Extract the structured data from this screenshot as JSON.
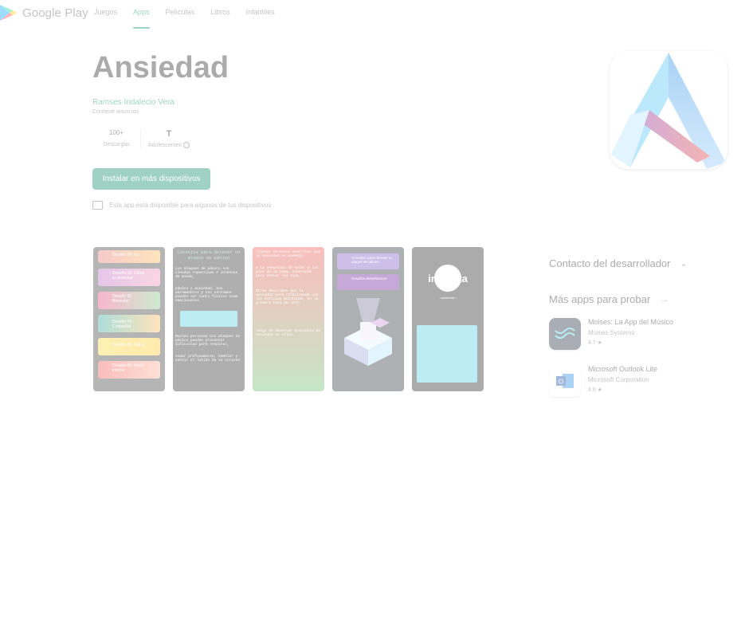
{
  "header": {
    "logo_text": "Google Play",
    "nav": [
      {
        "label": "Juegos",
        "active": false
      },
      {
        "label": "Apps",
        "active": true
      },
      {
        "label": "Películas",
        "active": false
      },
      {
        "label": "Libros",
        "active": false
      },
      {
        "label": "Infantiles",
        "active": false
      }
    ]
  },
  "app": {
    "title": "Ansiedad",
    "developer": "Ramses Indalecio Vera",
    "ads_note": "Contiene anuncios",
    "downloads_value": "100+",
    "downloads_label": "Descargas",
    "rating_icon": "T",
    "rating_label": "Adolescentes",
    "install_label": "Instalar en más dispositivos",
    "availability": "Esta app está disponible para algunos de tus dispositivos"
  },
  "screenshots": {
    "s1": [
      "Desafío 00: Ira",
      "Desafío 00: Cómo la ansiedad",
      "Desafío 00: Bienestar",
      "Desafío 00: Compañía",
      "Desafío 00: Salud",
      "Desafío 00: Ruido interno"
    ],
    "s2_title": "Consejos para detener un ataque de pánico",
    "s2_lines": [
      "Los ataques de pánico son oleadas repentinas e intensas de miedo,",
      "pánico o ansiedad. Son abrumadores y sus síntomas pueden ser tanto físicos como emocionales.",
      "Muchas personas con ataques de pánico pueden presentar dificultad para respirar,",
      "sudar profusamente, temblar y sentir el latido de su corazón"
    ],
    "s3_lines": [
      "Algunas personas describen que la ansiedad se asemeja",
      "a la sensación de estar a los pies de la cama, esperando para chocar los ojos.",
      "Otras describen que la ansiedad está relacionada con las noticias matutinas, en la primera taza de café,",
      "luego de observar episodios de ansiedad en ellos."
    ],
    "s4_items": [
      "Consejos para detener un ataque de pánico",
      "Desafíos Beneficiosos"
    ],
    "s5_title": "inquieta",
    "s5_sub": "• ansiedad •"
  },
  "sidebar": {
    "contact_title": "Contacto del desarrollador",
    "more_apps_title": "Más apps para probar",
    "recs": [
      {
        "name": "Moises: La App del Músico",
        "developer": "Moises Systems",
        "rating": "4.7 ★"
      },
      {
        "name": "Microsoft Outlook Lite",
        "developer": "Microsoft Corporation",
        "rating": "4.6 ★"
      }
    ]
  }
}
